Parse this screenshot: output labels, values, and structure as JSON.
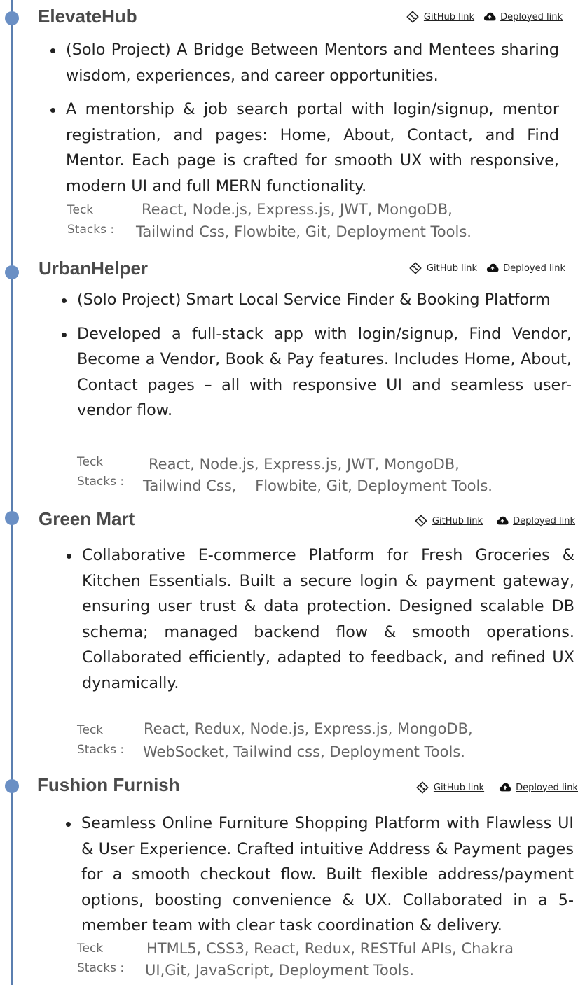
{
  "link_labels": {
    "github": "GitHub link",
    "deployed": "Deployed link"
  },
  "stack_label": {
    "line1": "Teck",
    "line2": "Stacks :"
  },
  "projects": [
    {
      "title": "ElevateHub",
      "bullets": [
        "(Solo Project) A Bridge Between Mentors and Mentees sharing wisdom, experiences, and career opportunities.",
        "A mentorship & job search portal with login/signup, mentor registration, and pages: Home, About, Contact, and Find Mentor. Each page is crafted for smooth UX with responsive, modern UI and full MERN functionality."
      ],
      "stack_line1": "React, Node.js, Express.js, JWT, MongoDB,",
      "stack_line2": "Tailwind Css, Flowbite, Git, Deployment Tools."
    },
    {
      "title": "UrbanHelper",
      "bullets": [
        "(Solo Project) Smart Local Service Finder & Booking Platform",
        "Developed a full-stack app with login/signup, Find Vendor, Become a Vendor, Book & Pay features. Includes Home, About, Contact pages – all with responsive UI and seamless user-vendor flow."
      ],
      "stack_line1": "React, Node.js, Express.js, JWT, MongoDB,",
      "stack_line2": "Tailwind Css,    Flowbite, Git, Deployment Tools."
    },
    {
      "title": "Green Mart",
      "bullets": [
        "Collaborative E-commerce Platform for Fresh Groceries & Kitchen Essentials. Built a secure login & payment gateway, ensuring user trust & data protection. Designed scalable DB schema; managed backend flow & smooth operations. Collaborated efficiently, adapted to feedback, and refined UX dynamically."
      ],
      "stack_line1": "React, Redux, Node.js, Express.js, MongoDB,",
      "stack_line2": "WebSocket, Tailwind css, Deployment Tools."
    },
    {
      "title": "Fushion Furnish",
      "bullets": [
        "Seamless Online Furniture Shopping Platform with Flawless UI & User Experience. Crafted intuitive Address & Payment pages for a smooth checkout flow. Built flexible address/payment options, boosting convenience & UX. Collaborated in a 5-member team with clear task coordination & delivery."
      ],
      "stack_line1": "HTML5, CSS3, React, Redux, RESTful APIs, Chakra",
      "stack_line2": "UI,Git, JavaScript, Deployment Tools."
    }
  ]
}
